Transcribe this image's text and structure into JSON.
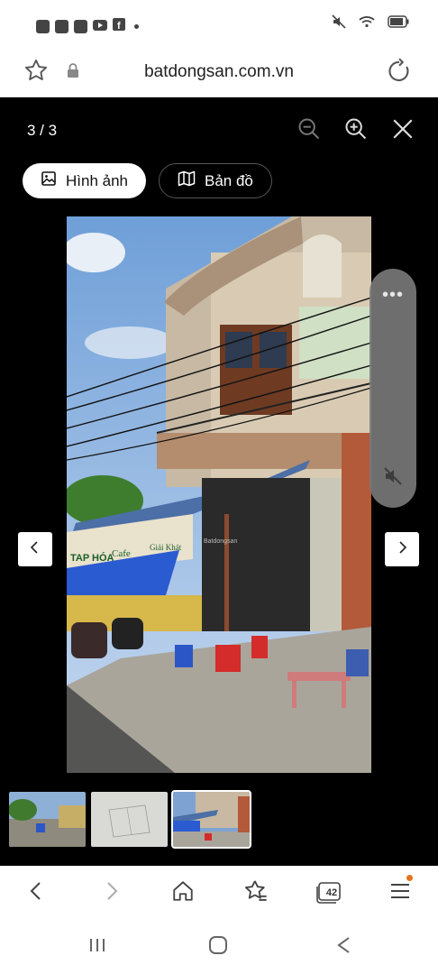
{
  "status_bar": {
    "notification_icons": [
      "app-icon",
      "app-icon",
      "app-icon",
      "youtube-icon",
      "facebook-icon"
    ],
    "right_icons": [
      "mute-icon",
      "wifi-icon",
      "battery-icon"
    ]
  },
  "browser": {
    "url": "batdongsan.com.vn",
    "tab_count": "42"
  },
  "viewer": {
    "counter": "3 / 3",
    "tabs": [
      {
        "label": "Hình ảnh",
        "icon": "image-icon",
        "active": true
      },
      {
        "label": "Bản đồ",
        "icon": "map-icon",
        "active": false
      }
    ],
    "watermark": "Batdongsan",
    "side_panel": {
      "more": "•••"
    },
    "shop_sign": {
      "left": "TAP HÓA",
      "center": "Cafe",
      "right": "Giải Khát"
    },
    "thumbnails": [
      {
        "name": "street-photo",
        "selected": false
      },
      {
        "name": "floor-plan",
        "selected": false
      },
      {
        "name": "shop-photo",
        "selected": true
      }
    ]
  },
  "colors": {
    "viewer_bg": "#000000",
    "active_tab_bg": "#ffffff",
    "notification_dot": "#e8711f"
  }
}
